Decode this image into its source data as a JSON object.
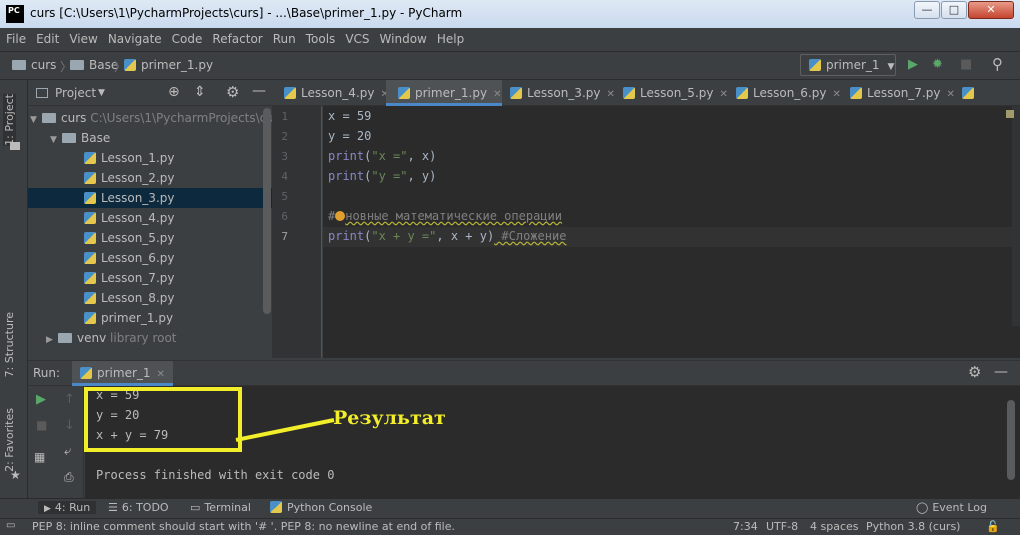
{
  "window": {
    "logo": "PC",
    "title": "curs [C:\\Users\\1\\PycharmProjects\\curs] - ...\\Base\\primer_1.py - PyCharm",
    "minimize": "—",
    "maximize": "□",
    "close": "✕"
  },
  "menu": [
    "File",
    "Edit",
    "View",
    "Navigate",
    "Code",
    "Refactor",
    "Run",
    "Tools",
    "VCS",
    "Window",
    "Help"
  ],
  "breadcrumb": {
    "root": "curs",
    "folder": "Base",
    "file": "primer_1.py",
    "sep": "〉"
  },
  "run_config": {
    "name": "primer_1",
    "caret": "▼"
  },
  "left_strip": {
    "project_tab": "1: Project",
    "structure_tab": "7: Structure",
    "favorites_tab": "2: Favorites"
  },
  "project_panel": {
    "title": "Project",
    "caret": "▼",
    "tree": [
      {
        "arrow": "▼",
        "name": "curs",
        "path": "C:\\Users\\1\\PycharmProjects\\cu",
        "type": "folder",
        "selected": false
      },
      {
        "arrow": "▼",
        "name": "Base",
        "path": "",
        "type": "folder",
        "selected": false
      },
      {
        "arrow": "",
        "name": "Lesson_1.py",
        "path": "",
        "type": "file",
        "selected": false
      },
      {
        "arrow": "",
        "name": "Lesson_2.py",
        "path": "",
        "type": "file",
        "selected": false
      },
      {
        "arrow": "",
        "name": "Lesson_3.py",
        "path": "",
        "type": "file",
        "selected": true
      },
      {
        "arrow": "",
        "name": "Lesson_4.py",
        "path": "",
        "type": "file",
        "selected": false
      },
      {
        "arrow": "",
        "name": "Lesson_5.py",
        "path": "",
        "type": "file",
        "selected": false
      },
      {
        "arrow": "",
        "name": "Lesson_6.py",
        "path": "",
        "type": "file",
        "selected": false
      },
      {
        "arrow": "",
        "name": "Lesson_7.py",
        "path": "",
        "type": "file",
        "selected": false
      },
      {
        "arrow": "",
        "name": "Lesson_8.py",
        "path": "",
        "type": "file",
        "selected": false
      },
      {
        "arrow": "",
        "name": "primer_1.py",
        "path": "",
        "type": "file",
        "selected": false
      },
      {
        "arrow": "▶",
        "name": "venv",
        "path": "library root",
        "type": "folder",
        "selected": false
      }
    ]
  },
  "tabs": [
    {
      "label": "Lesson_4.py",
      "active": false
    },
    {
      "label": "primer_1.py",
      "active": true
    },
    {
      "label": "Lesson_3.py",
      "active": false
    },
    {
      "label": "Lesson_5.py",
      "active": false
    },
    {
      "label": "Lesson_6.py",
      "active": false
    },
    {
      "label": "Lesson_7.py",
      "active": false
    }
  ],
  "tab_close": "✕",
  "editor": {
    "line_numbers": [
      "1",
      "2",
      "3",
      "4",
      "5",
      "6",
      "7"
    ],
    "lines": {
      "l1": "x = 59",
      "l2": "y = 20",
      "l3_fn": "print",
      "l3_args_open": "(",
      "l3_str": "\"x =\"",
      "l3_rest": ", x)",
      "l4_fn": "print",
      "l4_args_open": "(",
      "l4_str": "\"y =\"",
      "l4_rest": ", y)",
      "l6_hash": "#",
      "l6_comment": "новные математические операции",
      "l7_fn": "print",
      "l7_args_open": "(",
      "l7_str": "\"x + y =\"",
      "l7_rest": ", x + y)",
      "l7_comment": " #Сложение"
    }
  },
  "run_panel": {
    "label": "Run:",
    "tab": "primer_1",
    "output": [
      "x = 59",
      "y = 20",
      "x + y = 79",
      "",
      "Process finished with exit code 0"
    ]
  },
  "annotation": "Результат",
  "bottom_tabs": {
    "run": "4: Run",
    "todo": "6: TODO",
    "terminal": "Terminal",
    "python_console": "Python Console",
    "event_log": "Event Log"
  },
  "status": {
    "message": "PEP 8: inline comment should start with '# '. PEP 8: no newline at end of file.",
    "position": "7:34",
    "encoding": "UTF-8",
    "indent": "4 spaces",
    "interpreter": "Python 3.8 (curs)"
  },
  "colors": {
    "accent": "#4a88c7",
    "annotation": "#f2ee2a",
    "run_green": "#59a869"
  }
}
